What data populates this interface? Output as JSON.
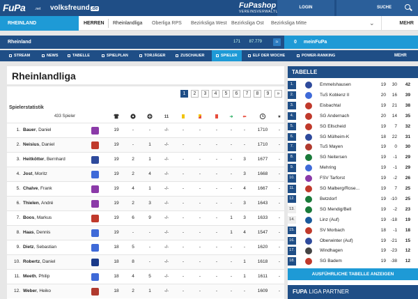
{
  "topbar": {
    "logo": "FuPa",
    "logo_suffix": ".net",
    "partner": "volksfreund",
    "partner_badge": ".de",
    "shop": "FuPashop",
    "shop_sub": "VEREINSVERWALTUNG",
    "login": "LOGIN",
    "search": "SUCHE"
  },
  "section": {
    "region": "RHEINLAND",
    "herren": "HERREN",
    "tabs": [
      "Rheinlandliga",
      "Oberliga RPS",
      "Bezirksliga West",
      "Bezirksliga Ost",
      "Bezirksliga Mitte"
    ],
    "more": "MEHR"
  },
  "league_bar": {
    "name": "Rheinland",
    "followers": "171",
    "views": "87.779",
    "rss": "RSS"
  },
  "meinfupa": {
    "count": "0",
    "label": "meinFuPa"
  },
  "nav": {
    "items": [
      "STREAM",
      "NEWS",
      "TABELLE",
      "SPIELPLAN",
      "TORJÄGER",
      "ZUSCHAUER",
      "SPIELER",
      "ELF DER WOCHE",
      "POWER-RANKING"
    ],
    "more": "MEHR"
  },
  "page": {
    "title": "Rheinlandliga",
    "stat_title": "Spielerstatistik",
    "player_count": "433 Spieler"
  },
  "pagination": [
    "1",
    "2",
    "3",
    "4",
    "5",
    "6",
    "7",
    "8",
    "9",
    "»"
  ],
  "columns": [
    "Spiele",
    "Tore",
    "Vorlagen",
    "Startelf",
    "Gelb",
    "Gelb-Rot",
    "Rot",
    "Eingewechselt",
    "Ausgewechselt",
    "Minuten",
    "Top-Elf"
  ],
  "column_header_11": "11",
  "players": [
    {
      "rank": "1.",
      "last": "Bauer",
      "first": "Daniel",
      "color": "#8b3aa8",
      "stats": [
        "19",
        "-",
        "-",
        "-/-",
        "-",
        "-",
        "-",
        "-",
        "-",
        "1710",
        "-"
      ]
    },
    {
      "rank": "2.",
      "last": "Neisius",
      "first": "Daniel",
      "color": "#c0392b",
      "stats": [
        "19",
        "-",
        "1",
        "-/-",
        "-",
        "-",
        "-",
        "-",
        "-",
        "1710",
        "-"
      ]
    },
    {
      "rank": "3.",
      "last": "Heitkötter",
      "first": "Bernhard",
      "color": "#2e4a9c",
      "stats": [
        "19",
        "2",
        "1",
        "-/-",
        "-",
        "-",
        "-",
        "-",
        "3",
        "1677",
        "-"
      ]
    },
    {
      "rank": "4.",
      "last": "Jost",
      "first": "Moritz",
      "color": "#3f6ad8",
      "stats": [
        "19",
        "2",
        "4",
        "-/-",
        "-",
        "-",
        "-",
        "-",
        "3",
        "1668",
        "-"
      ]
    },
    {
      "rank": "5.",
      "last": "Chalve",
      "first": "Frank",
      "color": "#8b3aa8",
      "stats": [
        "19",
        "4",
        "1",
        "-/-",
        "-",
        "-",
        "-",
        "-",
        "4",
        "1667",
        "-"
      ]
    },
    {
      "rank": "6.",
      "last": "Thielen",
      "first": "André",
      "color": "#8b3aa8",
      "stats": [
        "19",
        "2",
        "3",
        "-/-",
        "-",
        "-",
        "-",
        "-",
        "3",
        "1643",
        "-"
      ]
    },
    {
      "rank": "7.",
      "last": "Boos",
      "first": "Markus",
      "color": "#c0392b",
      "stats": [
        "19",
        "6",
        "9",
        "-/-",
        "-",
        "-",
        "-",
        "1",
        "3",
        "1633",
        "-"
      ]
    },
    {
      "rank": "8.",
      "last": "Haas",
      "first": "Dennis",
      "color": "#3f6ad8",
      "stats": [
        "19",
        "-",
        "-",
        "-/-",
        "-",
        "-",
        "-",
        "1",
        "4",
        "1547",
        "-"
      ]
    },
    {
      "rank": "9.",
      "last": "Dietz",
      "first": "Sebastian",
      "color": "#3f6ad8",
      "stats": [
        "18",
        "5",
        "-",
        "-/-",
        "-",
        "-",
        "-",
        "-",
        "-",
        "1620",
        "-"
      ]
    },
    {
      "rank": "10.",
      "last": "Robertz",
      "first": "Daniel",
      "color": "#1a3a8a",
      "stats": [
        "18",
        "8",
        "-",
        "-/-",
        "-",
        "-",
        "-",
        "-",
        "1",
        "1618",
        "-"
      ]
    },
    {
      "rank": "11.",
      "last": "Meeth",
      "first": "Philip",
      "color": "#3f6ad8",
      "stats": [
        "18",
        "4",
        "5",
        "-/-",
        "-",
        "-",
        "-",
        "-",
        "1",
        "1611",
        "-"
      ]
    },
    {
      "rank": "12.",
      "last": "Weber",
      "first": "Heiko",
      "color": "#b03a2e",
      "stats": [
        "18",
        "2",
        "1",
        "-/-",
        "-",
        "-",
        "-",
        "-",
        "-",
        "1609",
        "-"
      ]
    }
  ],
  "table": {
    "title": "TABELLE",
    "rows": [
      {
        "pos": "1.",
        "team": "Emmelshausen",
        "gp": "19",
        "gd": "30",
        "pts": "42",
        "color": "#2e4a9c"
      },
      {
        "pos": "2.",
        "team": "TuS Koblenz II",
        "gp": "20",
        "gd": "16",
        "pts": "39",
        "color": "#3f6ad8"
      },
      {
        "pos": "3.",
        "team": "Eisbachtal",
        "gp": "19",
        "gd": "21",
        "pts": "38",
        "color": "#c0392b"
      },
      {
        "pos": "4.",
        "team": "SG Andernach",
        "gp": "20",
        "gd": "14",
        "pts": "35",
        "color": "#c0392b"
      },
      {
        "pos": "5.",
        "team": "SG Ellscheid",
        "gp": "19",
        "gd": "7",
        "pts": "32",
        "color": "#c0392b"
      },
      {
        "pos": "6.",
        "team": "SG Mülheim-K",
        "gp": "18",
        "gd": "22",
        "pts": "31",
        "color": "#2e4a9c"
      },
      {
        "pos": "7.",
        "team": "TuS Mayen",
        "gp": "19",
        "gd": "0",
        "pts": "30",
        "color": "#b03a2e"
      },
      {
        "pos": "8.",
        "team": "SG Neitersen",
        "gp": "19",
        "gd": "-1",
        "pts": "29",
        "color": "#1a7a3a"
      },
      {
        "pos": "9.",
        "team": "Mehring",
        "gp": "19",
        "gd": "-1",
        "pts": "29",
        "color": "#3f6ad8"
      },
      {
        "pos": "10.",
        "team": "FSV Tarforst",
        "gp": "19",
        "gd": "-2",
        "pts": "26",
        "color": "#8b3aa8"
      },
      {
        "pos": "11.",
        "team": "SG Malberg/Rose...",
        "gp": "19",
        "gd": "7",
        "pts": "25",
        "color": "#c0392b"
      },
      {
        "pos": "12.",
        "team": "Betzdorf",
        "gp": "19",
        "gd": "-10",
        "pts": "25",
        "color": "#1a7a3a"
      },
      {
        "pos": "13.",
        "team": "SG Mendig/Bell",
        "gp": "19",
        "gd": "-2",
        "pts": "23",
        "color": "#1a7a3a"
      },
      {
        "pos": "14.",
        "team": "Linz (Auf)",
        "gp": "19",
        "gd": "-18",
        "pts": "19",
        "color": "#1a5a9c"
      },
      {
        "pos": "15.",
        "team": "SV Morbach",
        "gp": "18",
        "gd": "-1",
        "pts": "18",
        "color": "#c0392b"
      },
      {
        "pos": "16.",
        "team": "Oberwinter (Auf)",
        "gp": "19",
        "gd": "-21",
        "pts": "15",
        "color": "#2e4a9c"
      },
      {
        "pos": "17.",
        "team": "Windhagen",
        "gp": "19",
        "gd": "-23",
        "pts": "12",
        "color": "#444"
      },
      {
        "pos": "18.",
        "team": "SG Badem",
        "gp": "19",
        "gd": "-38",
        "pts": "12",
        "color": "#c0392b"
      }
    ],
    "more_button": "AUSFÜHRLICHE TABELLE ANZEIGEN"
  },
  "partner": {
    "brand": "FUPA",
    "label": "LIGA PARTNER"
  },
  "colors": {
    "navy": "#1f4e86",
    "accent": "#1e9ad6"
  }
}
